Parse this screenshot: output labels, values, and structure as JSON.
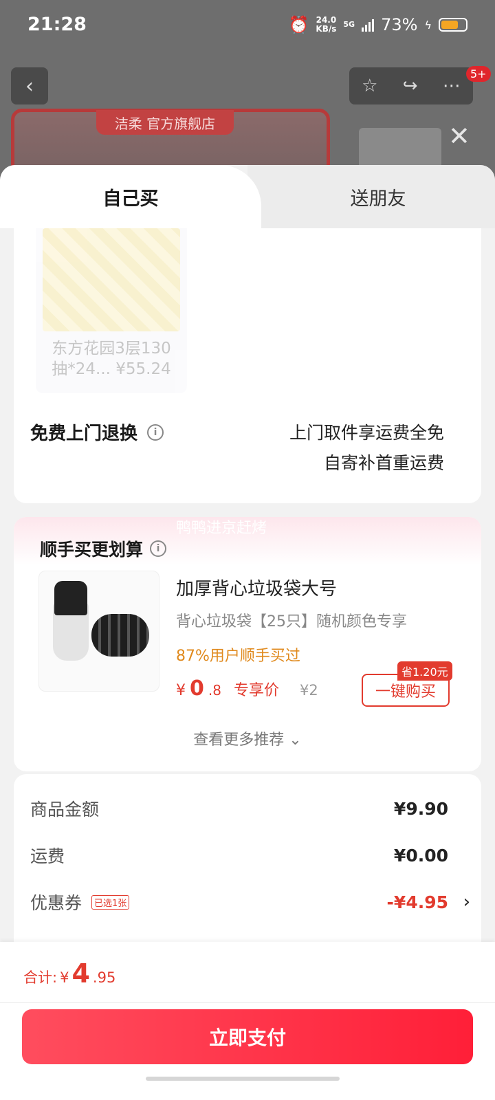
{
  "status": {
    "time": "21:28",
    "net_speed_value": "24.0",
    "net_speed_unit": "KB/s",
    "network": "5G",
    "battery": "73%"
  },
  "background": {
    "store_name": "洁柔 官方旗舰店",
    "badge": "5+"
  },
  "tabs": {
    "self": "自己买",
    "friend": "送朋友"
  },
  "product": {
    "name_line1": "东方花园3层130",
    "name_line2": "抽*24... ¥55.24"
  },
  "returns": {
    "label": "免费上门退换",
    "line1": "上门取件享运费全免",
    "line2": "自寄补首重运费"
  },
  "upsell": {
    "watermark": "鸭鸭进京赶烤",
    "title": "顺手买更划算",
    "item": {
      "name": "加厚背心垃圾袋大号",
      "spec": "背心垃圾袋【25只】随机颜色专享",
      "stat": "87%用户顺手买过",
      "price_yen": "¥",
      "price_int": "0",
      "price_dec": ".8",
      "price_tag": "专享价",
      "orig_price": "¥2",
      "save_badge": "省1.20元",
      "buy_label": "一键购买"
    },
    "more": "查看更多推荐"
  },
  "summary": {
    "goods_label": "商品金额",
    "goods_value": "¥9.90",
    "shipping_label": "运费",
    "shipping_value": "¥0.00",
    "coupon_label": "优惠券",
    "coupon_tag": "已选1张",
    "coupon_value": "-¥4.95"
  },
  "footer": {
    "total_label": "合计:",
    "total_yen": "¥",
    "total_int": "4",
    "total_dec": ".95",
    "pay_label": "立即支付"
  },
  "colors": {
    "accent": "#e23b2e",
    "pay_button": "#ff2a40",
    "stat": "#e08a1e"
  }
}
